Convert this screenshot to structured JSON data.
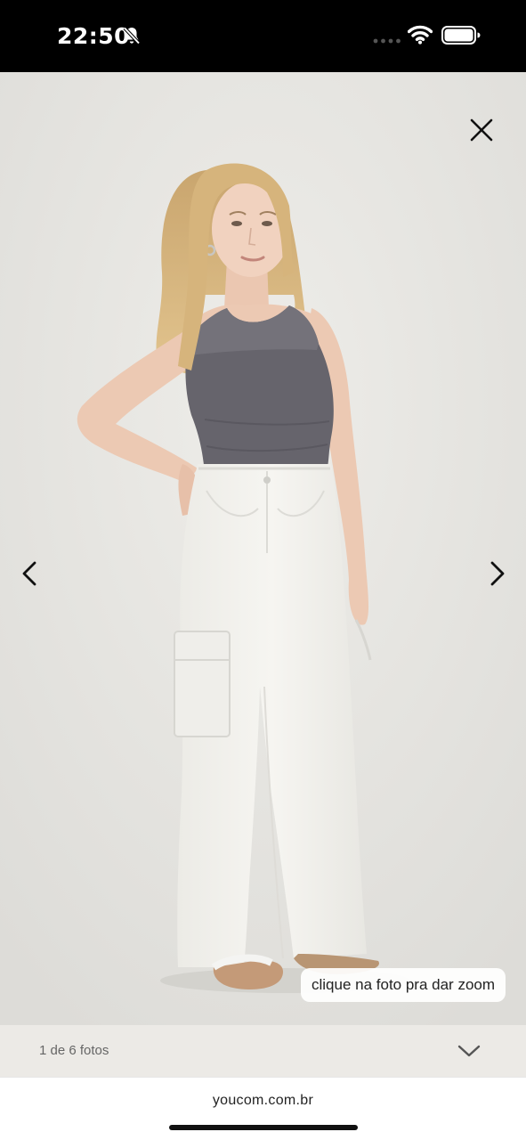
{
  "status_bar": {
    "time": "22:50",
    "icons": [
      "bell-slash-icon",
      "signal-icon",
      "wifi-icon",
      "battery-icon"
    ]
  },
  "viewer": {
    "zoom_hint": "clique na foto pra dar zoom",
    "photo_counter": "1 de 6 fotos",
    "icons": [
      "close-icon",
      "chevron-left-icon",
      "chevron-right-icon",
      "chevron-down-icon"
    ]
  },
  "browser": {
    "url": "youcom.com.br"
  },
  "colors": {
    "background": "#e5e4e0",
    "top_garment": "#66646c",
    "pants": "#f3f2ee"
  }
}
